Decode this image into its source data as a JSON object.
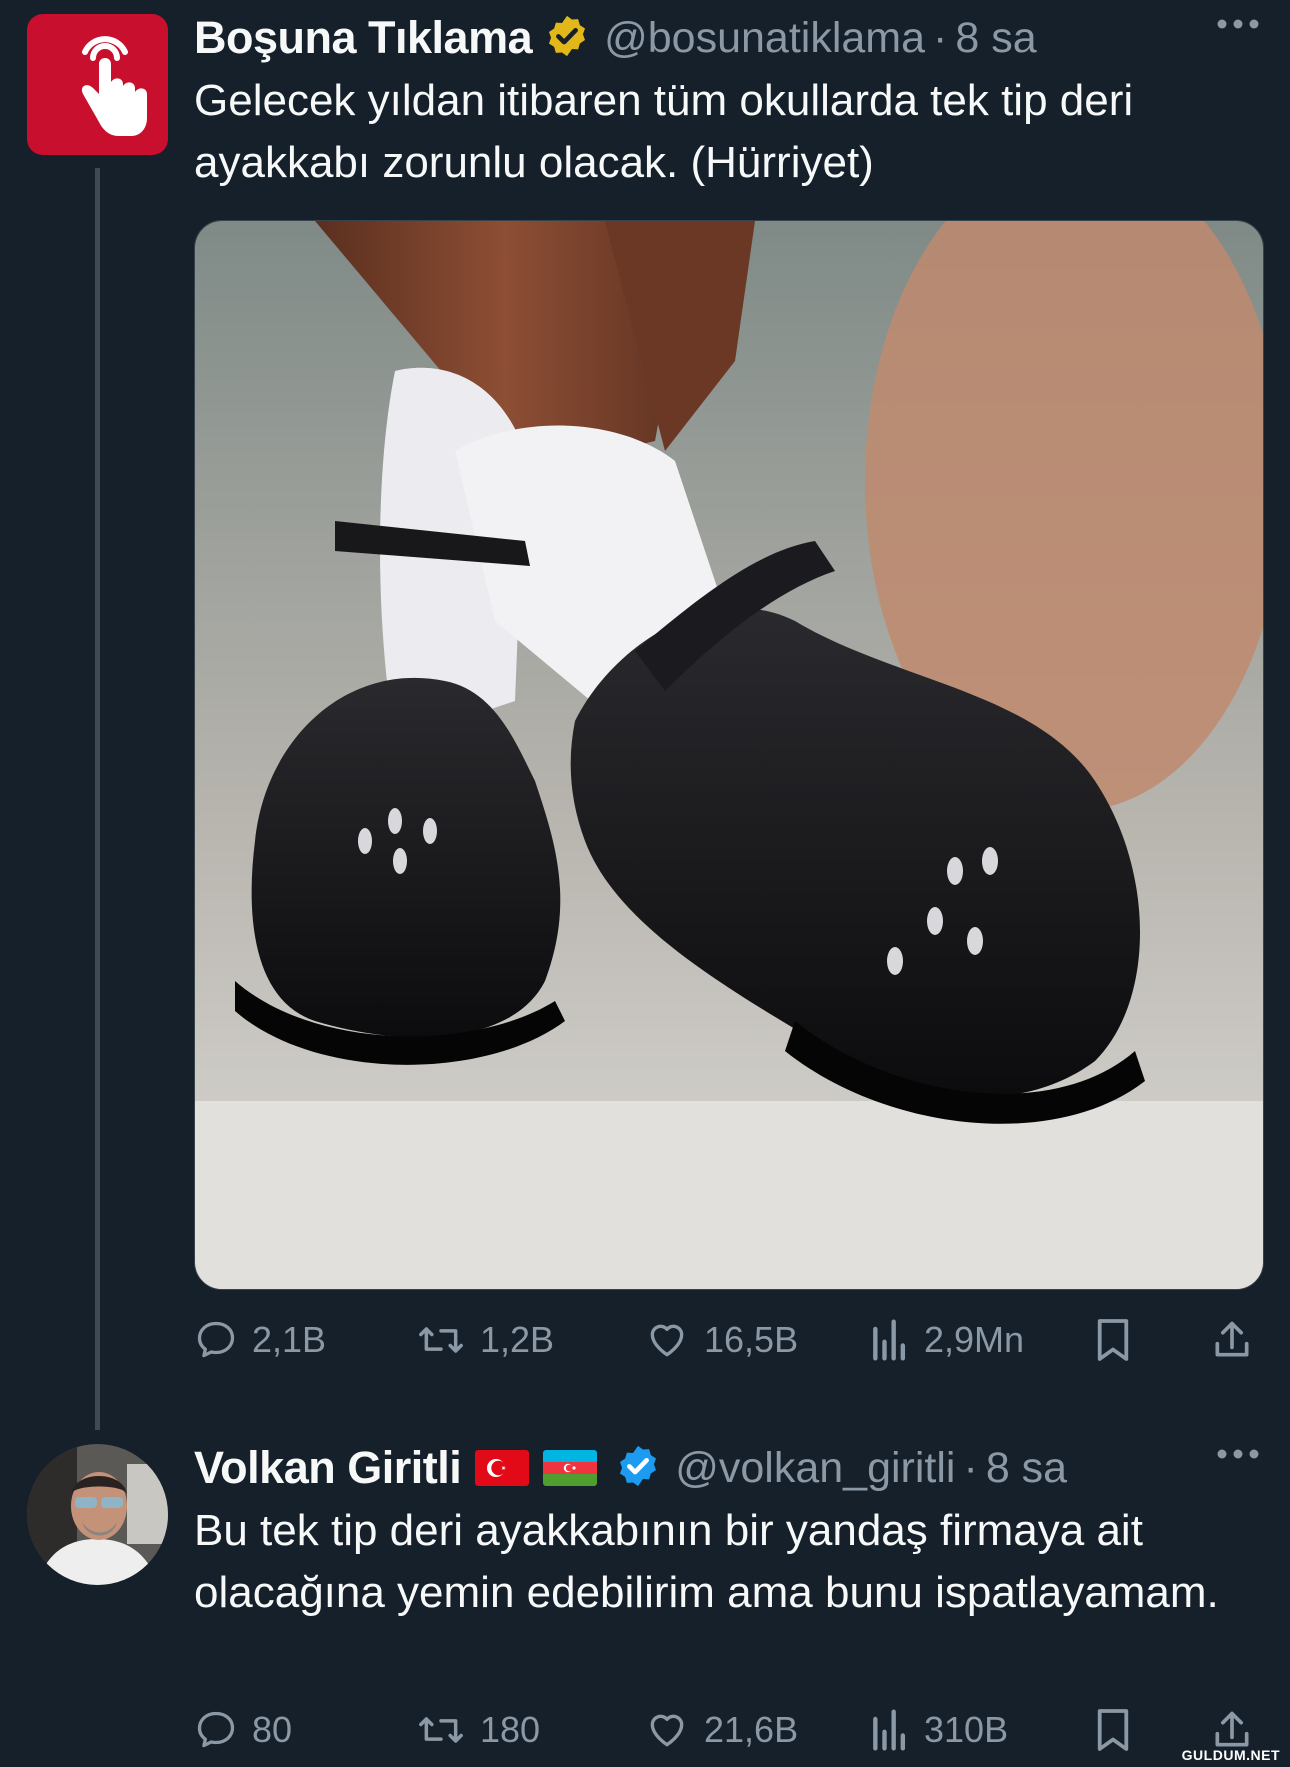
{
  "tweet1": {
    "name": "Boşuna Tıklama",
    "handle": "@bosunatiklama",
    "separator": "·",
    "time": "8 sa",
    "text": "Gelecek yıldan itibaren tüm okullarda tek tip deri ayakkabı zorunlu olacak. (Hürriyet)",
    "badge_color": "#e2b719",
    "avatar_color": "#c8102e",
    "stats": {
      "replies": "2,1B",
      "retweets": "1,2B",
      "likes": "16,5B",
      "views": "2,9Mn"
    }
  },
  "tweet2": {
    "name": "Volkan Giritli",
    "handle": "@volkan_giritli",
    "separator": "·",
    "time": "8 sa",
    "text": "Bu tek tip deri ayakkabının bir yandaş firmaya ait olacağına yemin edebilirim ama bunu ispatlayamam.",
    "badge_color": "#1d9bf0",
    "flags": [
      "turkey-flag",
      "azerbaijan-flag"
    ],
    "stats": {
      "replies": "80",
      "retweets": "180",
      "likes": "21,6B",
      "views": "310B"
    }
  },
  "theme": {
    "background": "#15202b",
    "muted_text": "#8b98a5",
    "thread_line": "#3e4a55"
  },
  "watermark": "GULDUM.NET"
}
